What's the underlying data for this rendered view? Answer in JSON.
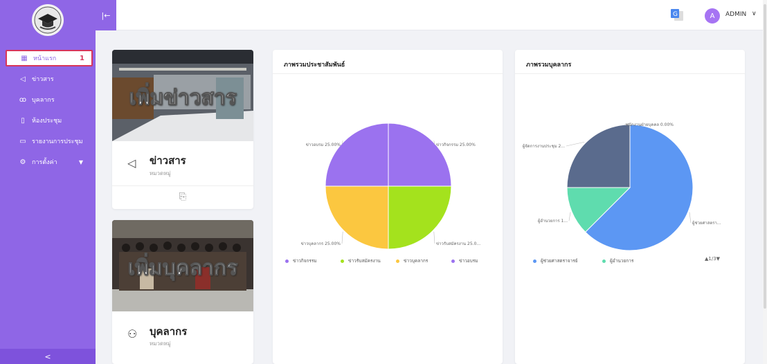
{
  "sidebar": {
    "items": [
      {
        "label": "หน้าแรก",
        "icon": "grid-icon",
        "badge": "1"
      },
      {
        "label": "ข่าวสาร",
        "icon": "megaphone-icon"
      },
      {
        "label": "บุคลากร",
        "icon": "users-icon"
      },
      {
        "label": "ห้องประชุม",
        "icon": "building-icon"
      },
      {
        "label": "รายงานการประชุม",
        "icon": "report-icon"
      },
      {
        "label": "การตั้งค่า",
        "icon": "gear-icon"
      }
    ],
    "collapse_glyph": "<"
  },
  "topbar": {
    "toggle_glyph": "|←",
    "avatar_initial": "A",
    "user_name": "ADMIN"
  },
  "cards": {
    "news": {
      "image_text": "เพิ่มข่าวสาร",
      "title": "ข่าวสาร",
      "subtitle": "หมวดหมู่"
    },
    "staff": {
      "image_text": "เพิ่มบุคลากร",
      "title": "บุคลากร",
      "subtitle": "หมวดหมู่"
    }
  },
  "colors": {
    "primary": "#8f66e6",
    "active_border": "#d8365a",
    "slice_purple": "#9b72ef",
    "slice_green": "#a4e21d",
    "slice_yellow": "#fbc740",
    "slice_blue": "#5c97f3",
    "slice_teal": "#5fdcae",
    "slice_slate": "#5a6b8d"
  },
  "chart_data": [
    {
      "type": "pie",
      "title": "ภาพรวมประชาสัมพันธ์",
      "series": [
        {
          "name": "ข่าวกิจกรรม",
          "value": 25.0,
          "label": "ข่าวกิจกรรม 25.00%",
          "color": "#9b72ef"
        },
        {
          "name": "ข่าวรับสมัครงาน",
          "value": 25.0,
          "label": "ข่าวรับสมัครงาน 25.0...",
          "color": "#a4e21d"
        },
        {
          "name": "ข่าวบุคลากร",
          "value": 25.0,
          "label": "ข่าวบุคลากร 25.00%",
          "color": "#fbc740"
        },
        {
          "name": "ข่าวอบรม",
          "value": 25.0,
          "label": "ข่าวอบรม 25.00%",
          "color": "#9b72ef"
        }
      ],
      "legend": [
        "ข่าวกิจกรรม",
        "ข่าวรับสมัครงาน",
        "ข่าวบุคลากร",
        "ข่าวอบรม"
      ]
    },
    {
      "type": "pie",
      "title": "ภาพรวมบุคลากร",
      "series": [
        {
          "name": "ผู้ช่วยศาสตราจารย์",
          "value": 62.5,
          "label": "ผู้ช่วยศาสตรา...",
          "color": "#5c97f3"
        },
        {
          "name": "ผู้อำนวยการ",
          "value": 12.5,
          "label": "ผู้อำนวยการ 1...",
          "color": "#5fdcae"
        },
        {
          "name": "ผู้จัดการงานประชุม",
          "value": 25.0,
          "label": "ผู้จัดการงานประชุม 2...",
          "color": "#5a6b8d"
        },
        {
          "name": "พนักงานฝ่ายบุคคล",
          "value": 0.0,
          "label": "พนักงานฝ่ายบุคคล 0.00%",
          "color": "#9b72ef"
        }
      ],
      "legend": [
        "ผู้ช่วยศาสตราจารย์",
        "ผู้อำนวยการ"
      ],
      "pager": "1/3"
    }
  ]
}
